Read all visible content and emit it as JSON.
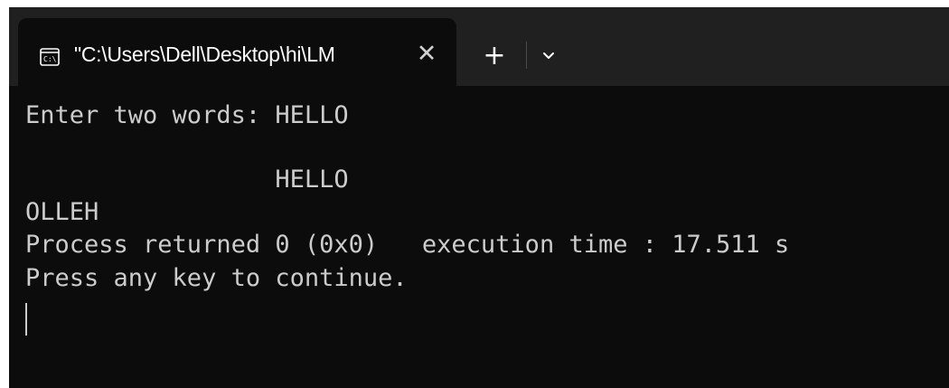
{
  "tab": {
    "title": "\"C:\\Users\\Dell\\Desktop\\hi\\LM",
    "close_glyph": "✕",
    "icon": "console-icon"
  },
  "toolbar": {
    "new_tab_glyph": "+",
    "dropdown_icon": "chevron-down-icon"
  },
  "terminal": {
    "lines": [
      "Enter two words: HELLO",
      "",
      "                 HELLO",
      "OLLEH",
      "Process returned 0 (0x0)   execution time : 17.511 s",
      "Press any key to continue."
    ]
  },
  "colors": {
    "background": "#0c0c0c",
    "titlebar": "#202020",
    "text": "#cccccc"
  }
}
